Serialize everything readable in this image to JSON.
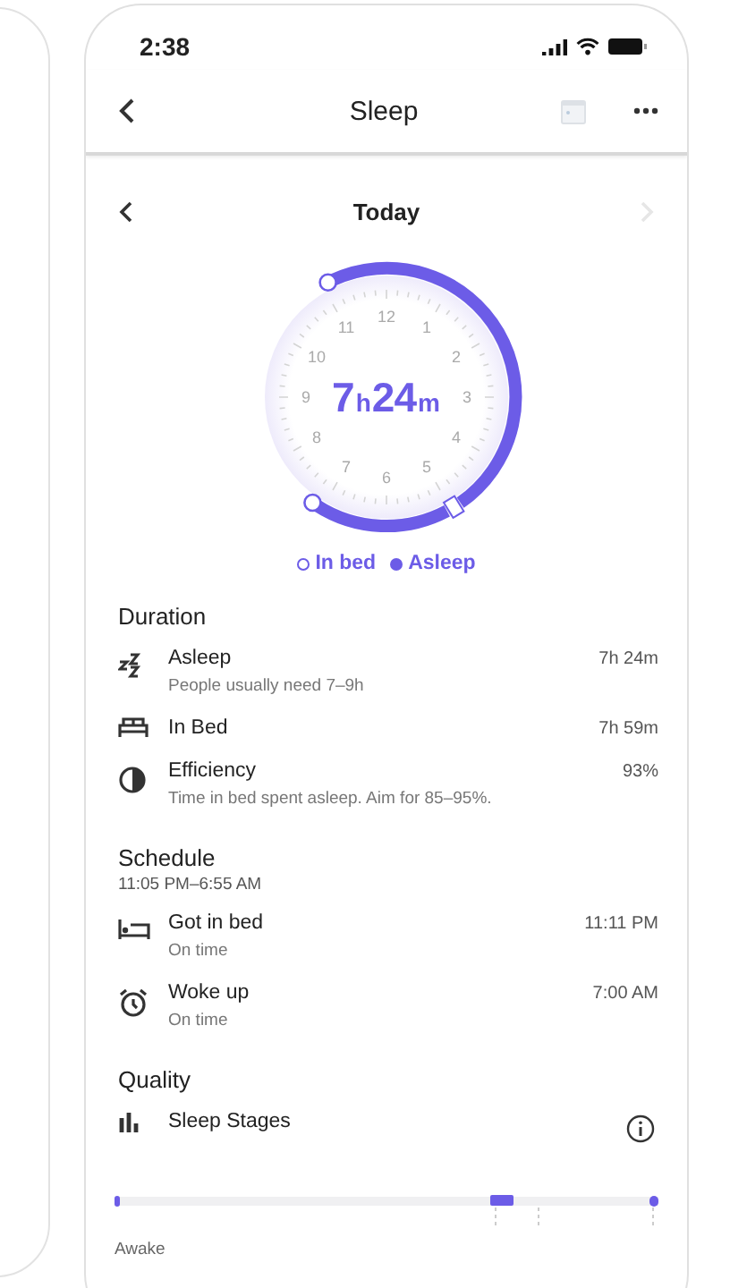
{
  "status_bar": {
    "time": "2:38"
  },
  "header": {
    "title": "Sleep"
  },
  "date_nav": {
    "label": "Today",
    "next_disabled": true
  },
  "dial": {
    "hours": "7",
    "hours_unit": "h",
    "minutes": "24",
    "minutes_unit": "m",
    "clock_numbers": [
      "12",
      "1",
      "2",
      "3",
      "4",
      "5",
      "6",
      "7",
      "8",
      "9",
      "10",
      "11"
    ]
  },
  "legend": [
    {
      "label": "In bed",
      "kind": "hollow"
    },
    {
      "label": "Asleep",
      "kind": "filled"
    }
  ],
  "sections": [
    {
      "title": "Duration",
      "rows": [
        {
          "kind": "zzz",
          "label": "Asleep",
          "sub": "People usually need 7–9h",
          "value": "7h 24m"
        },
        {
          "kind": "bed",
          "label": "In Bed",
          "value": "7h 59m"
        },
        {
          "kind": "efficiency",
          "label": "Efficiency",
          "sub": "Time in bed spent asleep. Aim for 85–95%.",
          "value": "93%"
        }
      ]
    },
    {
      "title": "Schedule",
      "subtitle": "11:05 PM–6:55 AM",
      "rows": [
        {
          "kind": "bedtime",
          "label": "Got in bed",
          "sub": "On time",
          "value": "11:11 PM"
        },
        {
          "kind": "wake",
          "label": "Woke up",
          "sub": "On time",
          "value": "7:00 AM"
        }
      ]
    },
    {
      "title": "Quality",
      "rows": [
        {
          "kind": "stages",
          "label": "Sleep Stages",
          "info": true
        }
      ]
    }
  ],
  "stages": {
    "label": "Awake"
  }
}
